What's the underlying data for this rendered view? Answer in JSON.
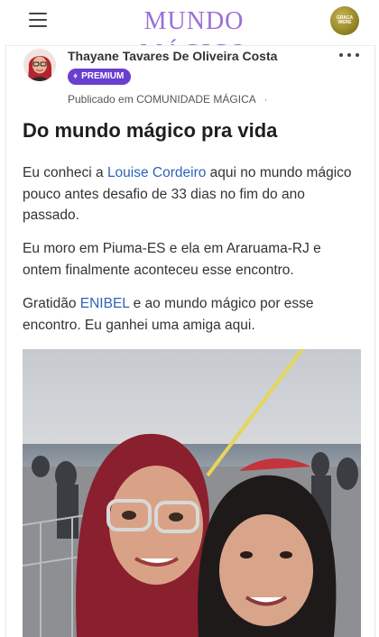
{
  "header": {
    "brand": "MUNDO MÁGICO",
    "badge_text": "GRACA WERE",
    "menu_icon": "hamburger-menu-icon",
    "accent_color": "#9b6fd6"
  },
  "post": {
    "author": "Thayane Tavares De Oliveira Costa",
    "badge": "PREMIUM",
    "badge_icon": "diamond-icon",
    "published_prefix": "Publicado em",
    "community": "COMUNIDADE MÁGICA",
    "separator": "·",
    "title": "Do mundo mágico pra vida",
    "p1_before": "Eu conheci a ",
    "p1_link": "Louise Cordeiro",
    "p1_after": " aqui no mundo mágico pouco antes desafio de 33 dias no fim do ano passado.",
    "p2": "Eu moro em Piuma-ES e ela em Araruama-RJ e ontem finalmente aconteceu esse encontro.",
    "p3_before": "Gratidão ",
    "p3_link": "ENIBEL",
    "p3_after": " e ao mundo mágico por esse encontro. Eu ganhei uma amiga aqui.",
    "link_color": "#2f63b8",
    "premium_color": "#6a3fd0"
  }
}
